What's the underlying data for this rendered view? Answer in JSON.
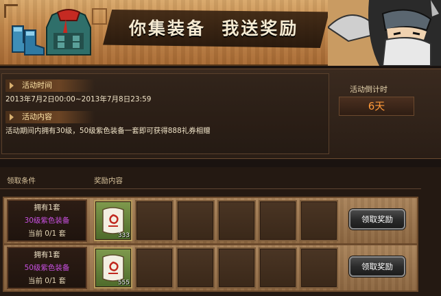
{
  "banner": {
    "title": "你集装备  我送奖励",
    "left_icons": [
      "boots-icon",
      "vest-icon"
    ],
    "right_art": "ninja-character"
  },
  "info": {
    "time_label": "活动时间",
    "time_value": "2013年7月2日00:00~2013年7月8日23:59",
    "content_label": "活动内容",
    "content_value": "活动期间内拥有30级，50级紫色装备一套即可获得888礼券相赠",
    "countdown_label": "活动倒计时",
    "countdown_value": "6天"
  },
  "rewards": {
    "headers": {
      "condition": "领取条件",
      "content": "奖励内容"
    },
    "rows": [
      {
        "own": "拥有1套",
        "requirement": "30级紫色装备",
        "current": "当前 0/1 套",
        "item_count": "333",
        "button": "领取奖励"
      },
      {
        "own": "拥有1套",
        "requirement": "50级紫色装备",
        "current": "当前 0/1 套",
        "item_count": "555",
        "button": "领取奖励"
      }
    ]
  },
  "colors": {
    "purple_req": "#c850e0",
    "countdown": "#ff9a3a",
    "panel_bg": "#2a1e16"
  }
}
